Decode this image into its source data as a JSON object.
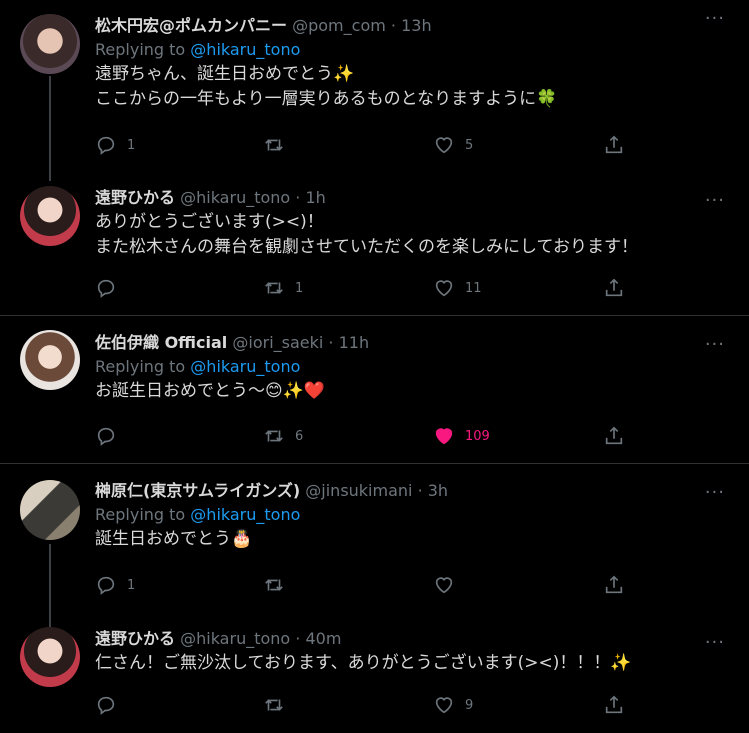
{
  "tweets": [
    {
      "name": "松木円宏@ポムカンパニー",
      "handle": "@pom_com",
      "time": "· 13h",
      "replying_prefix": "Replying to",
      "replying_handle": "@hikaru_tono",
      "text_line1": "遠野ちゃん、誕生日おめでとう✨",
      "text_line2": "ここからの一年もより一層実りあるものとなりますように🍀",
      "reply_count": "1",
      "retweet_count": "",
      "like_count": "5",
      "liked": false
    },
    {
      "name": "遠野ひかる",
      "handle": "@hikaru_tono",
      "time": "· 1h",
      "text_line1": "ありがとうございます(><)！",
      "text_line2": "また松木さんの舞台を観劇させていただくのを楽しみにしております！",
      "reply_count": "",
      "retweet_count": "1",
      "like_count": "11",
      "liked": false
    },
    {
      "name": "佐伯伊織 Official",
      "handle": "@iori_saeki",
      "time": "· 11h",
      "replying_prefix": "Replying to",
      "replying_handle": "@hikaru_tono",
      "text_line1": "お誕生日おめでとう〜😊✨❤️",
      "reply_count": "",
      "retweet_count": "6",
      "like_count": "109",
      "liked": true
    },
    {
      "name": "榊原仁(東京サムライガンズ)",
      "handle": "@jinsukimani",
      "time": "· 3h",
      "replying_prefix": "Replying to",
      "replying_handle": "@hikaru_tono",
      "text_line1": "誕生日おめでとう🎂",
      "reply_count": "1",
      "retweet_count": "",
      "like_count": "",
      "liked": false
    },
    {
      "name": "遠野ひかる",
      "handle": "@hikaru_tono",
      "time": "· 40m",
      "text_line1": "仁さん！ご無沙汰しております、ありがとうございます(><)！！！✨",
      "reply_count": "",
      "retweet_count": "",
      "like_count": "9",
      "liked": false
    }
  ],
  "more_label": "···",
  "colors": {
    "background": "#000000",
    "text": "#d9d9d9",
    "muted": "#6e767d",
    "link": "#1d9bf0",
    "like": "#f91880",
    "divider": "#2f3336"
  },
  "icons": [
    "reply-icon",
    "retweet-icon",
    "like-icon",
    "share-icon",
    "more-icon"
  ]
}
